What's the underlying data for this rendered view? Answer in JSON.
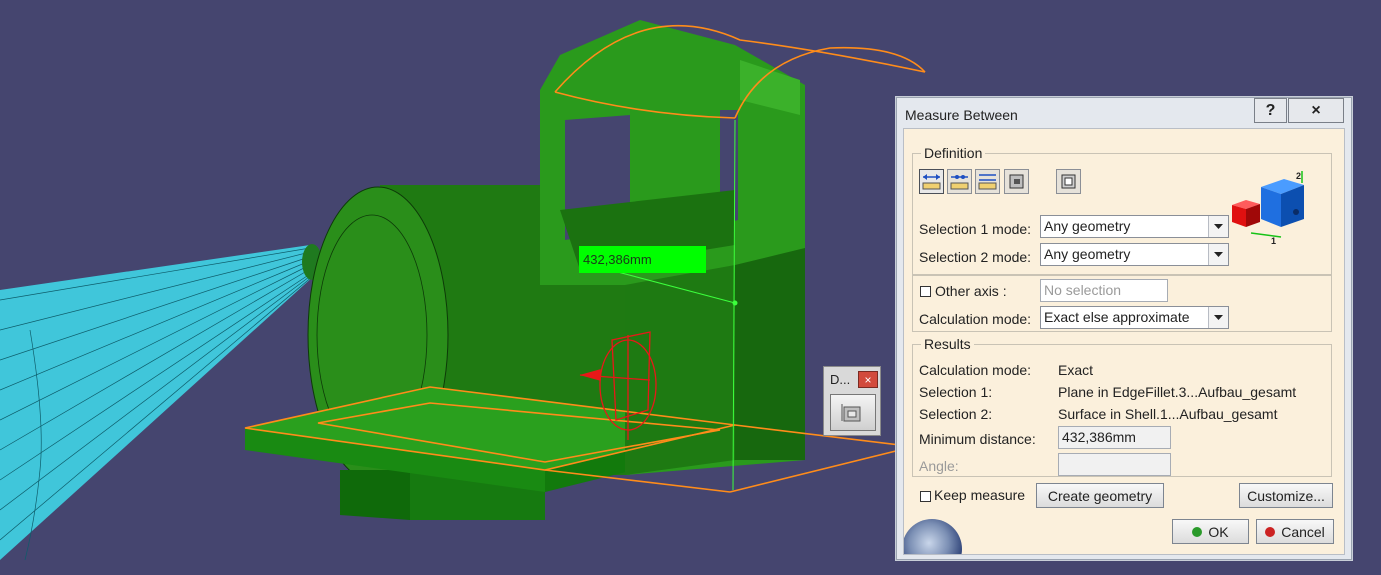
{
  "viewport": {
    "dimension_label": "432,386mm"
  },
  "mini_toolbar": {
    "title": "D...",
    "close_glyph": "×",
    "button_icon": "measure-tool-icon"
  },
  "dialog": {
    "title": "Measure Between",
    "help_label": "?",
    "close_label": "×",
    "definition": {
      "group_label": "Definition",
      "mode_icons": [
        "measure-between-icon",
        "measure-chain-icon",
        "measure-fan-icon",
        "measure-item-icon",
        "measure-thickness-icon"
      ],
      "selection1_label": "Selection 1 mode:",
      "selection1_value": "Any geometry",
      "selection2_label": "Selection 2 mode:",
      "selection2_value": "Any geometry",
      "other_axis_label": "Other axis :",
      "other_axis_checked": false,
      "other_axis_placeholder": "No selection",
      "calc_mode_label": "Calculation mode:",
      "calc_mode_value": "Exact else approximate"
    },
    "results": {
      "group_label": "Results",
      "rows": [
        {
          "label": "Calculation mode:",
          "value": "Exact"
        },
        {
          "label": "Selection 1:",
          "value": "Plane in EdgeFillet.3...Aufbau_gesamt"
        },
        {
          "label": "Selection 2:",
          "value": "Surface in Shell.1...Aufbau_gesamt"
        }
      ],
      "min_distance_label": "Minimum distance:",
      "min_distance_value": "432,386mm",
      "angle_label": "Angle:",
      "angle_value": ""
    },
    "keep_measure_label": "Keep measure",
    "keep_measure_checked": false,
    "create_geometry_label": "Create geometry",
    "customize_label": "Customize...",
    "ok_label": "OK",
    "cancel_label": "Cancel",
    "colors": {
      "ok_dot": "#2a9a2a",
      "cancel_dot": "#cc2222",
      "dimension_label_bg": "#00ff00",
      "viewport_bg": "#45456f"
    }
  }
}
